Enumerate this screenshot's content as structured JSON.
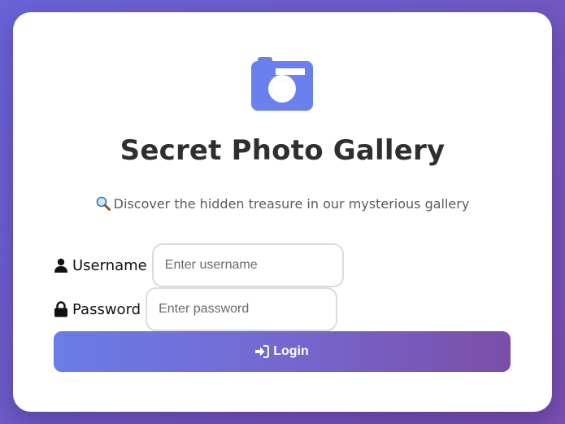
{
  "header": {
    "logo_icon": "camera-icon",
    "title": "Secret Photo Gallery",
    "subtitle_icon": "magnifying-glass-icon",
    "subtitle": "Discover the hidden treasure in our mysterious gallery"
  },
  "form": {
    "username": {
      "icon": "user-icon",
      "label": "Username",
      "placeholder": "Enter username",
      "value": ""
    },
    "password": {
      "icon": "lock-icon",
      "label": "Password",
      "placeholder": "Enter password",
      "value": ""
    },
    "login_button": {
      "icon": "sign-in-icon",
      "label": "Login"
    }
  },
  "colors": {
    "background_gradient": [
      "#6a63d8",
      "#7a4fb0"
    ],
    "accent": "#6b80ef",
    "button_gradient": [
      "#6a7ce8",
      "#7b4ea8"
    ],
    "title": "#2f2f2f"
  }
}
